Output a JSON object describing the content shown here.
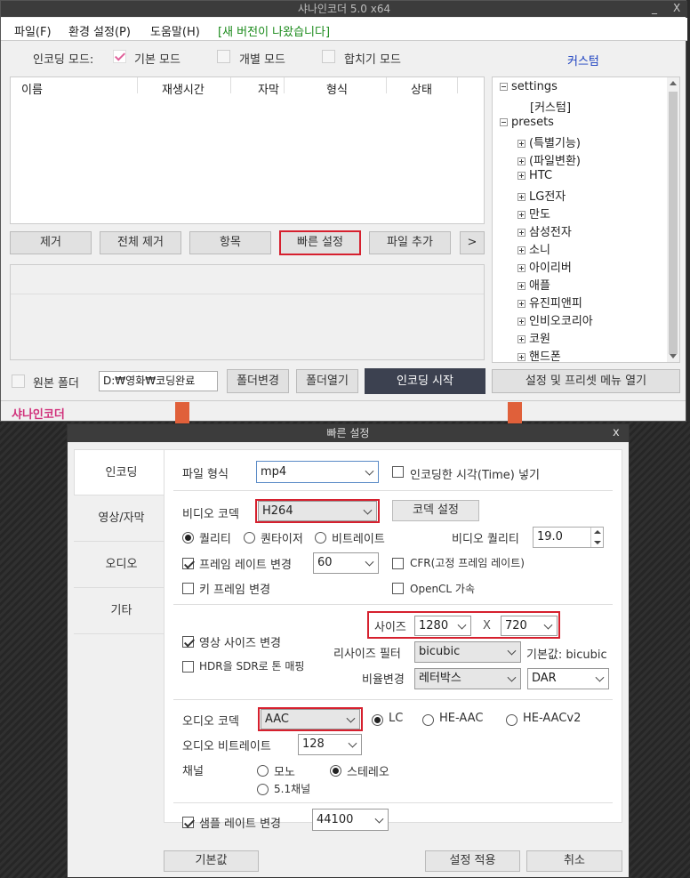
{
  "main_window": {
    "title": "샤나인코더  5.0  x64",
    "minimize": "_",
    "close": "X",
    "menu": [
      "파일(F)",
      "환경 설정(P)",
      "도움말(H)"
    ],
    "new_version": "[새 버전이 나왔습니다]",
    "mode_label": "인코딩 모드:",
    "modes": [
      "기본 모드",
      "개별 모드",
      "합치기 모드"
    ],
    "custom_link": "커스텀",
    "columns": [
      "이름",
      "재생시간",
      "자막",
      "형식",
      "상태"
    ],
    "buttons": [
      "제거",
      "전체 제거",
      "항목",
      "빠른 설정",
      "파일 추가",
      ">"
    ],
    "source_folder_label": "원본 폴더",
    "output_path": "D:₩영화₩코딩완료",
    "folder_change": "폴더변경",
    "folder_open": "폴더열기",
    "start_encoding": "인코딩 시작",
    "open_settings": "설정 및 프리셋 메뉴 열기",
    "brand": "샤나인코더",
    "tree": {
      "settings": "settings",
      "settings_child": "[커스텀]",
      "presets": "presets",
      "preset_items": [
        "(특별기능)",
        "(파일변환)",
        "HTC",
        "LG전자",
        "만도",
        "삼성전자",
        "소니",
        "아이리버",
        "애플",
        "유진피앤피",
        "인비오코리아",
        "코원",
        "핸드폰"
      ]
    }
  },
  "quick": {
    "title": "빠른 설정",
    "close": "x",
    "tabs": [
      "인코딩",
      "영상/자막",
      "오디오",
      "기타"
    ],
    "file_format_label": "파일 형식",
    "file_format": "mp4",
    "time_in_name": "인코딩한 시각(Time) 넣기",
    "video_codec_label": "비디오 코덱",
    "video_codec": "H264",
    "codec_settings": "코덱 설정",
    "rate_modes": [
      "퀄리티",
      "퀀타이저",
      "비트레이트"
    ],
    "video_quality_label": "비디오 퀄리티",
    "video_quality": "19.0",
    "frame_rate_label": "프레임 레이트 변경",
    "frame_rate": "60",
    "cfr_label": "CFR(고정 프레임 레이트)",
    "keyframe_label": "키 프레임 변경",
    "opencl_label": "OpenCL 가속",
    "size_label": "사이즈",
    "width": "1280",
    "x": "X",
    "height": "720",
    "resize_label": "영상 사이즈 변경",
    "hdr_label": "HDR을 SDR로 톤 매핑",
    "resize_filter_label": "리사이즈 필터",
    "resize_filter": "bicubic",
    "default_filter": "기본값: bicubic",
    "ratio_label": "비율변경",
    "ratio": "레터박스",
    "dar": "DAR",
    "audio_codec_label": "오디오 코덱",
    "audio_codec": "AAC",
    "aac_modes": [
      "LC",
      "HE-AAC",
      "HE-AACv2"
    ],
    "audio_bitrate_label": "오디오 비트레이트",
    "audio_bitrate": "128",
    "channel_label": "채널",
    "channels": [
      "모노",
      "스테레오",
      "5.1채널"
    ],
    "sample_rate_label": "샘플 레이트 변경",
    "sample_rate": "44100",
    "defaults": "기본값",
    "apply": "설정 적용",
    "cancel": "취소"
  },
  "colors": {
    "highlight": "#d6202e",
    "arrow": "#e0603a",
    "brand": "#d0307a",
    "link": "#1a3fc0",
    "start_btn": "#3c4150"
  }
}
